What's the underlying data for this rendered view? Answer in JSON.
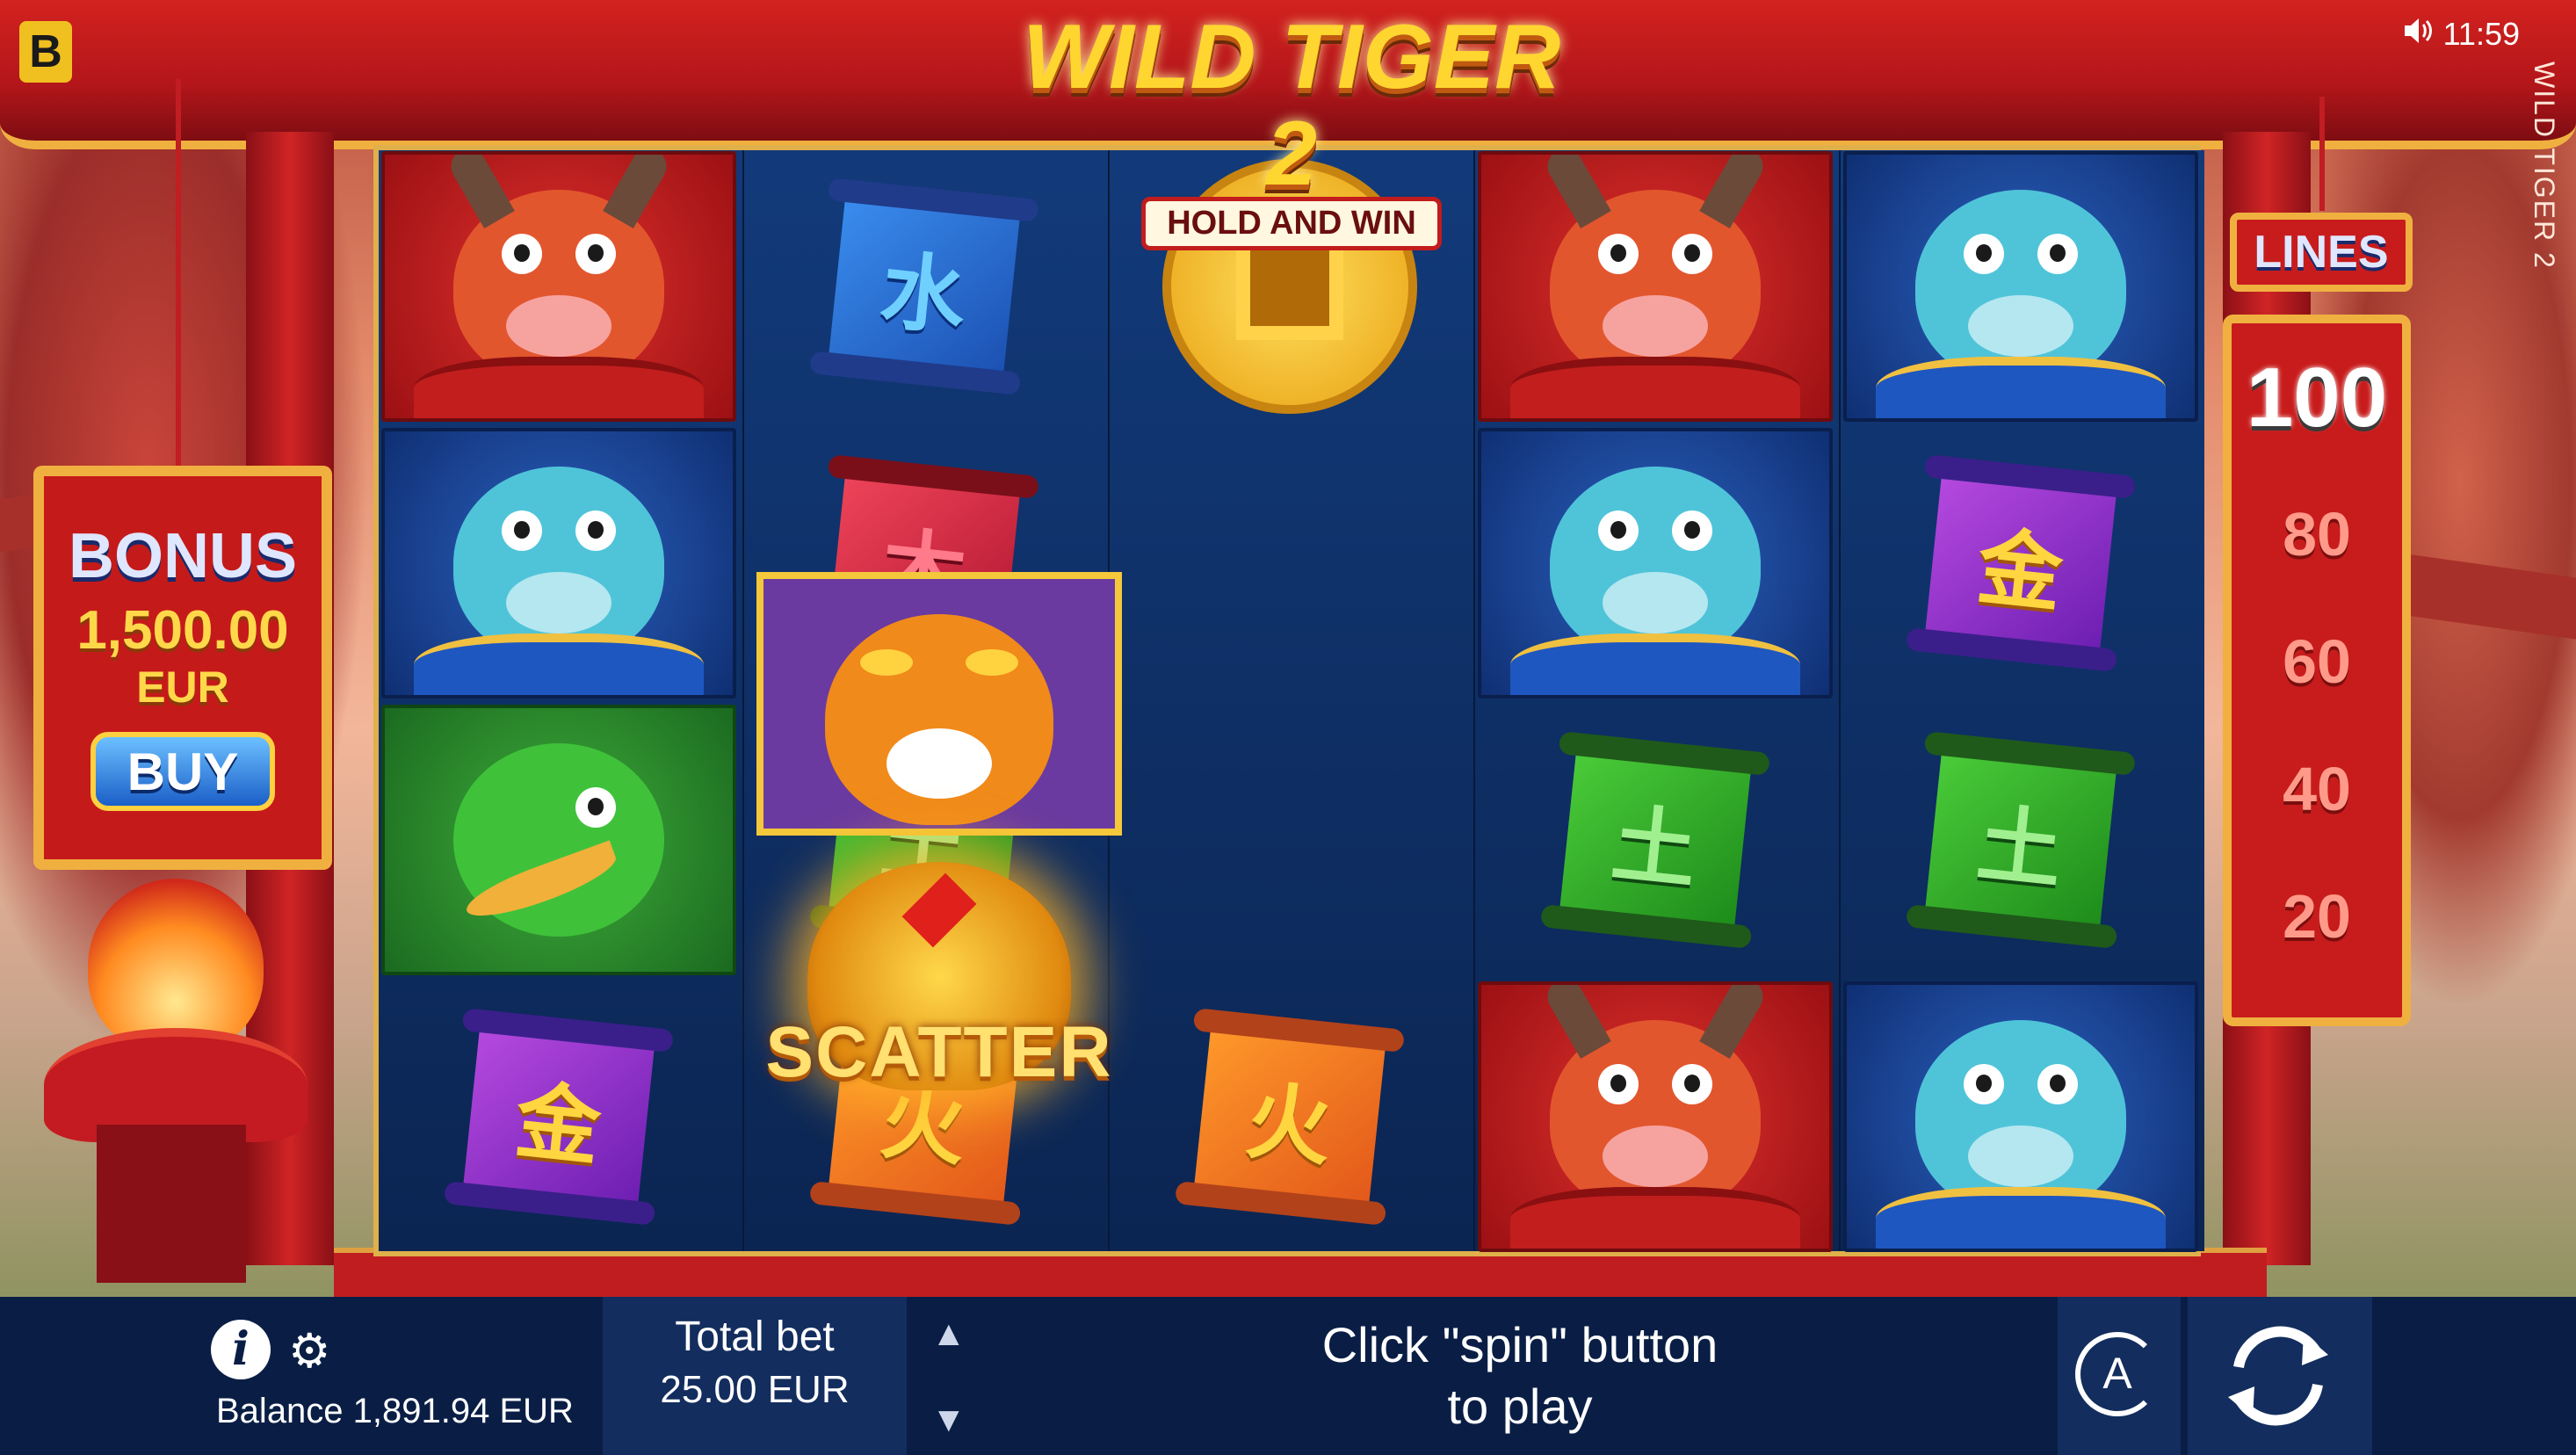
{
  "brand": {
    "letter": "B"
  },
  "status": {
    "time": "11:59",
    "sound_icon": "speaker-icon"
  },
  "game_title_vertical": "WILD TIGER 2",
  "logo": {
    "title": "WILD TIGER 2",
    "subtitle": "HOLD AND WIN"
  },
  "bonus": {
    "title": "BONUS",
    "amount": "1,500.00",
    "currency": "EUR",
    "buy_label": "BUY"
  },
  "lines": {
    "header": "LINES",
    "options": [
      "100",
      "80",
      "60",
      "40",
      "20"
    ],
    "selected": "100"
  },
  "reels": [
    [
      "bull",
      "frog",
      "crane",
      "scroll-purple"
    ],
    [
      "scroll-blue",
      "scroll-red",
      "scroll-green",
      "scroll-orange"
    ],
    [
      "coin",
      "tiger",
      "scatter",
      "scroll-orange"
    ],
    [
      "bull",
      "frog",
      "scroll-green",
      "bull"
    ],
    [
      "frog",
      "scroll-purple",
      "scroll-green",
      "frog"
    ]
  ],
  "symbols": {
    "scatter_label": "SCATTER",
    "glyph_water": "水",
    "glyph_wood": "木",
    "glyph_earth": "土",
    "glyph_metal": "金",
    "glyph_fire": "火"
  },
  "bottom_bar": {
    "info_label": "i",
    "gear_icon": "gear-icon",
    "balance": "Balance 1,891.94 EUR",
    "total_bet_label": "Total bet",
    "total_bet_value": "25.00 EUR",
    "bet_up": "▲",
    "bet_down": "▼",
    "prompt_line1": "Click \"spin\" button",
    "prompt_line2": "to play",
    "autoplay_label": "A",
    "spin_icon": "spin-icon"
  },
  "colors": {
    "accent_gold": "#f0b040",
    "frame_red": "#c81c1c",
    "bar_navy": "#0a1e45"
  }
}
